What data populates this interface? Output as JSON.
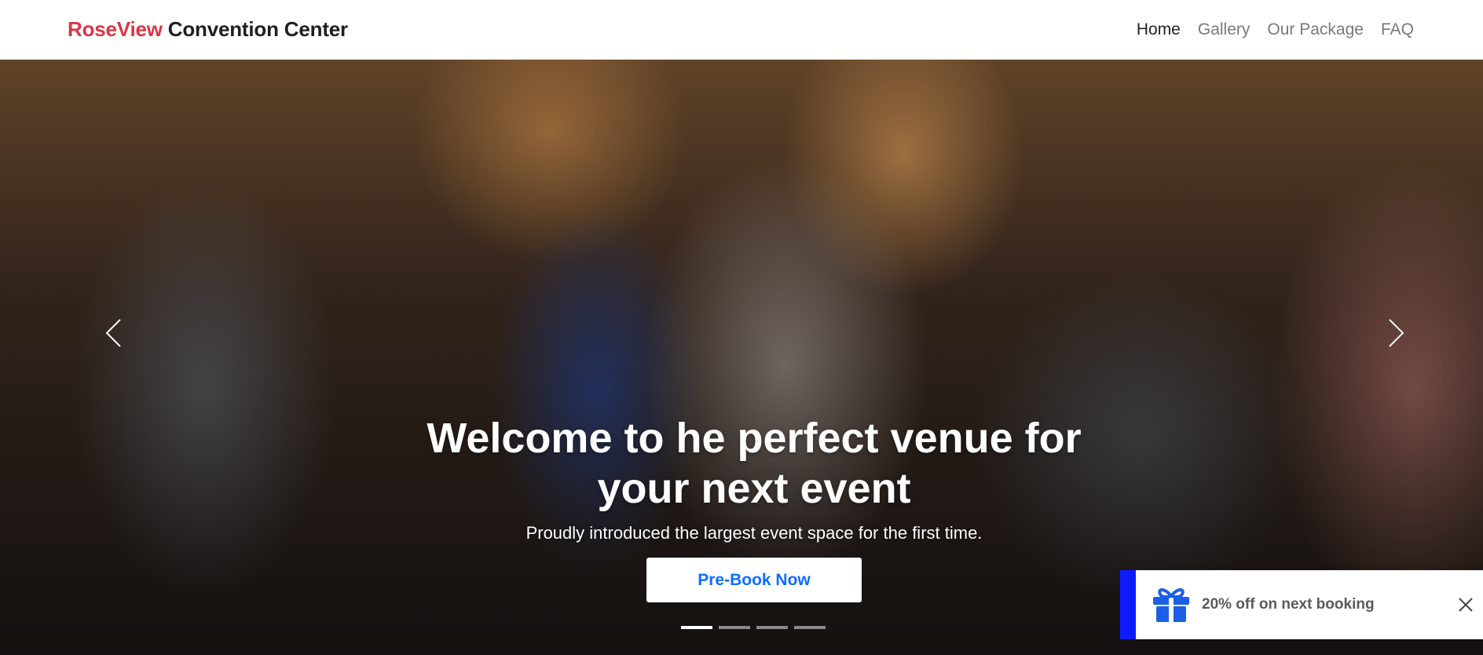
{
  "brand": {
    "accent": "RoseView",
    "rest": " Convention Center"
  },
  "nav": [
    {
      "label": "Home",
      "active": true
    },
    {
      "label": "Gallery"
    },
    {
      "label": "Our Package"
    },
    {
      "label": "FAQ"
    }
  ],
  "hero": {
    "title": "Welcome to he perfect venue for your next event",
    "subtitle": "Proudly introduced the largest event space for the first time.",
    "cta_label": "Pre-Book Now",
    "slide_count": 4,
    "active_slide": 1,
    "prev_icon": "chevron-left-icon",
    "next_icon": "chevron-right-icon"
  },
  "promo": {
    "text": "20% off on next booking",
    "icon": "gift-icon",
    "close_icon": "close-icon"
  },
  "colors": {
    "brand_accent": "#dc3545",
    "primary": "#0d6efd",
    "toast_bar": "#0d1cff"
  }
}
